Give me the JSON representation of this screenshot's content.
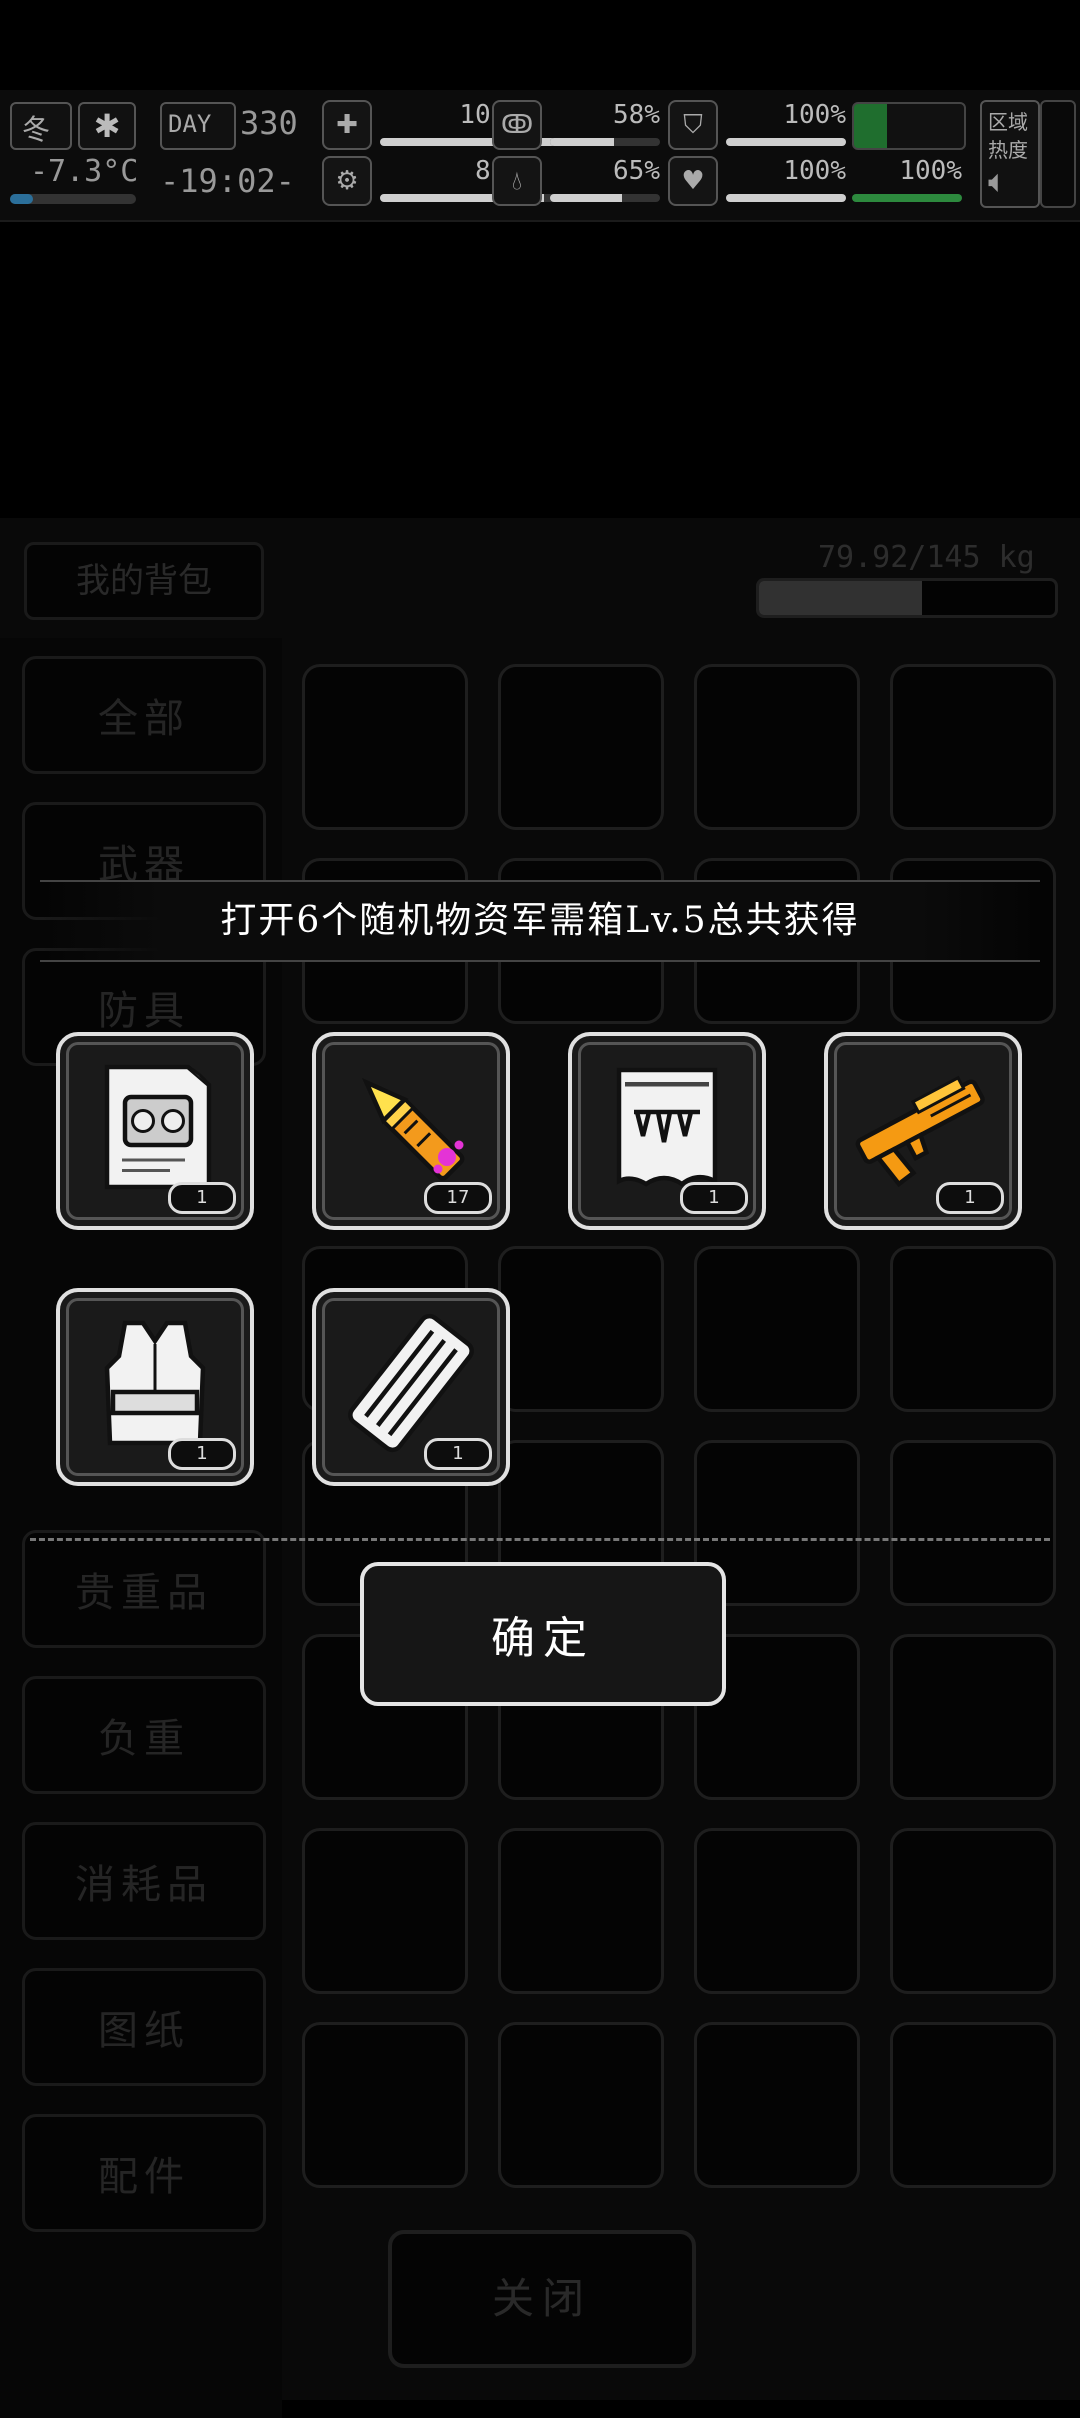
{
  "hud": {
    "season": "冬",
    "day_label": "DAY",
    "day": "330",
    "temperature": "-7.3°C",
    "time": "-19:02-",
    "region_label": "区域热度",
    "stats": [
      {
        "icon": "medkit-icon",
        "value": "100%",
        "level": 1.0
      },
      {
        "icon": "stomach-icon",
        "value": "58%",
        "level": 0.58
      },
      {
        "icon": "shield-icon",
        "value": "100%",
        "level": 1.0
      },
      {
        "icon": "brain-icon",
        "value": "82%",
        "level": 0.82
      },
      {
        "icon": "water-drop-icon",
        "value": "65%",
        "level": 0.65
      },
      {
        "icon": "heart-icon",
        "value": "100%",
        "level": 1.0
      },
      {
        "icon": "stamina-icon",
        "value": "100%",
        "level": 1.0
      }
    ]
  },
  "backpack": {
    "title": "我的背包",
    "weight": "79.92/145 kg",
    "weight_fraction": 0.55,
    "categories": [
      "全部",
      "武器",
      "防具",
      "贵重品",
      "负重",
      "消耗品",
      "图纸",
      "配件"
    ],
    "close_label": "关闭"
  },
  "popup": {
    "banner": "打开6个随机物资军需箱Lv.5总共获得",
    "rewards": [
      {
        "name": "engine-blueprint",
        "count": "1"
      },
      {
        "name": "rocket-ammo",
        "count": "17"
      },
      {
        "name": "jaw-trap-blueprint",
        "count": "1"
      },
      {
        "name": "orange-shotgun",
        "count": "1"
      },
      {
        "name": "tactical-vest",
        "count": "1"
      },
      {
        "name": "magazine",
        "count": "1"
      }
    ],
    "confirm_label": "确定"
  }
}
